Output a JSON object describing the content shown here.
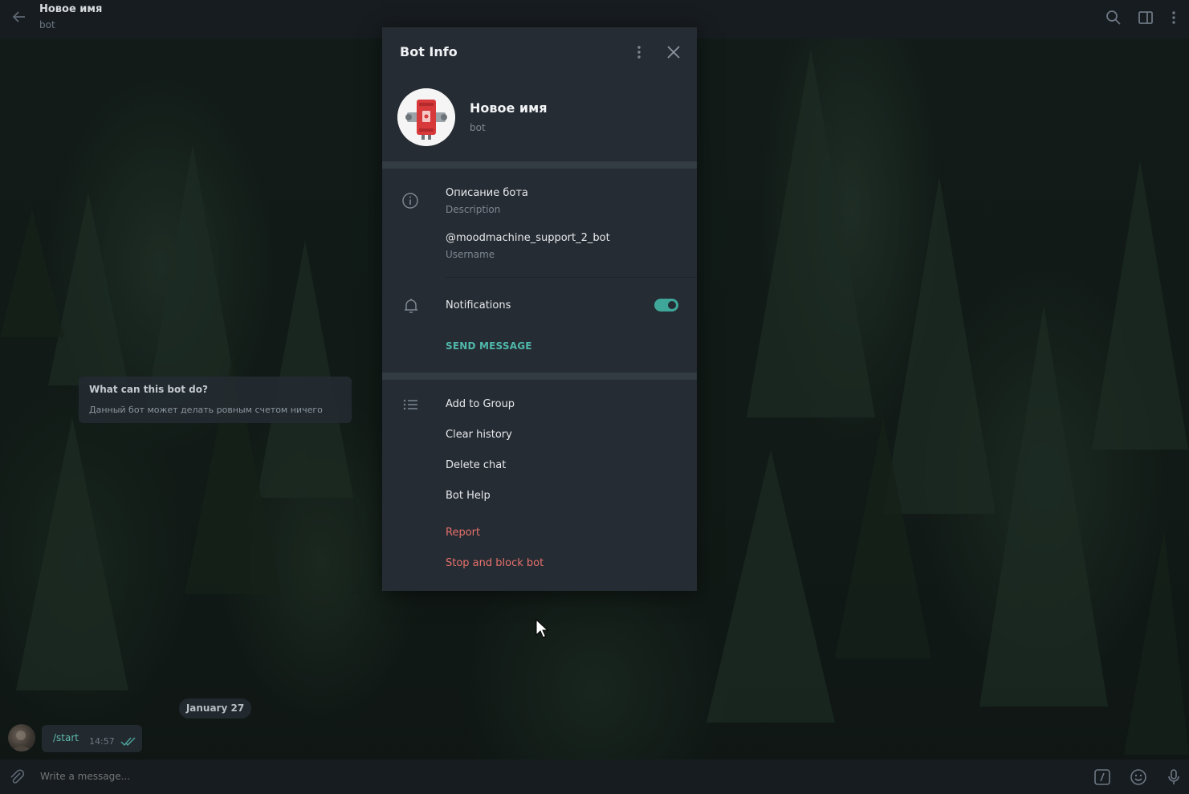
{
  "header": {
    "title": "Новое имя",
    "subtitle": "bot",
    "icons": [
      "back-arrow-icon",
      "search-icon",
      "sidebar-toggle-icon",
      "more-vertical-icon"
    ]
  },
  "chat": {
    "bot_card": {
      "title": "What can this bot do?",
      "text": "Данный бот может делать ровным счетом ничего"
    },
    "date_separator": "January 27",
    "message": {
      "text": "/start",
      "time": "14:57",
      "status_icon": "double-check-icon"
    }
  },
  "composer": {
    "placeholder": "Write a message...",
    "icons": [
      "attach-icon",
      "bot-command-icon",
      "emoji-icon",
      "microphone-icon"
    ]
  },
  "modal": {
    "title": "Bot Info",
    "icons": [
      "more-vertical-icon",
      "close-icon"
    ],
    "profile": {
      "name": "Новое имя",
      "type": "bot"
    },
    "info": {
      "description_value": "Описание бота",
      "description_label": "Description",
      "username_value": "@moodmachine_support_2_bot",
      "username_label": "Username"
    },
    "notifications": {
      "label": "Notifications",
      "enabled": true
    },
    "send_message_label": "SEND MESSAGE",
    "actions": [
      {
        "label": "Add to Group",
        "danger": false
      },
      {
        "label": "Clear history",
        "danger": false
      },
      {
        "label": "Delete chat",
        "danger": false
      },
      {
        "label": "Bot Help",
        "danger": false
      },
      {
        "label": "Report",
        "danger": true
      },
      {
        "label": "Stop and block bot",
        "danger": true
      }
    ]
  },
  "colors": {
    "accent": "#50b8ab",
    "danger": "#e5716c",
    "panel": "#262c33",
    "header": "#171c20"
  }
}
